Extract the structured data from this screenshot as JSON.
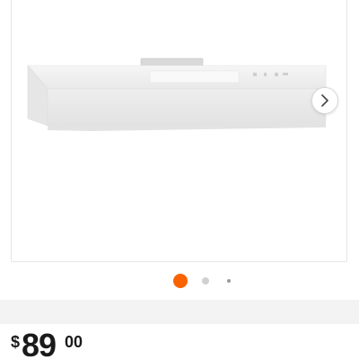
{
  "colors": {
    "accent": "#f96302",
    "dot_inactive": "#d0d0d0",
    "dot_small": "#9a9a9a",
    "divider": "#f3f3f3",
    "frame_border": "#e6e6e6"
  },
  "gallery": {
    "image_icon": "range-hood-image",
    "next_icon": "chevron-right-icon",
    "slides": [
      {
        "active": true
      },
      {
        "active": false
      },
      {
        "active": false
      }
    ]
  },
  "price": {
    "currency": "$",
    "dollars": "89",
    "cents": "00"
  }
}
